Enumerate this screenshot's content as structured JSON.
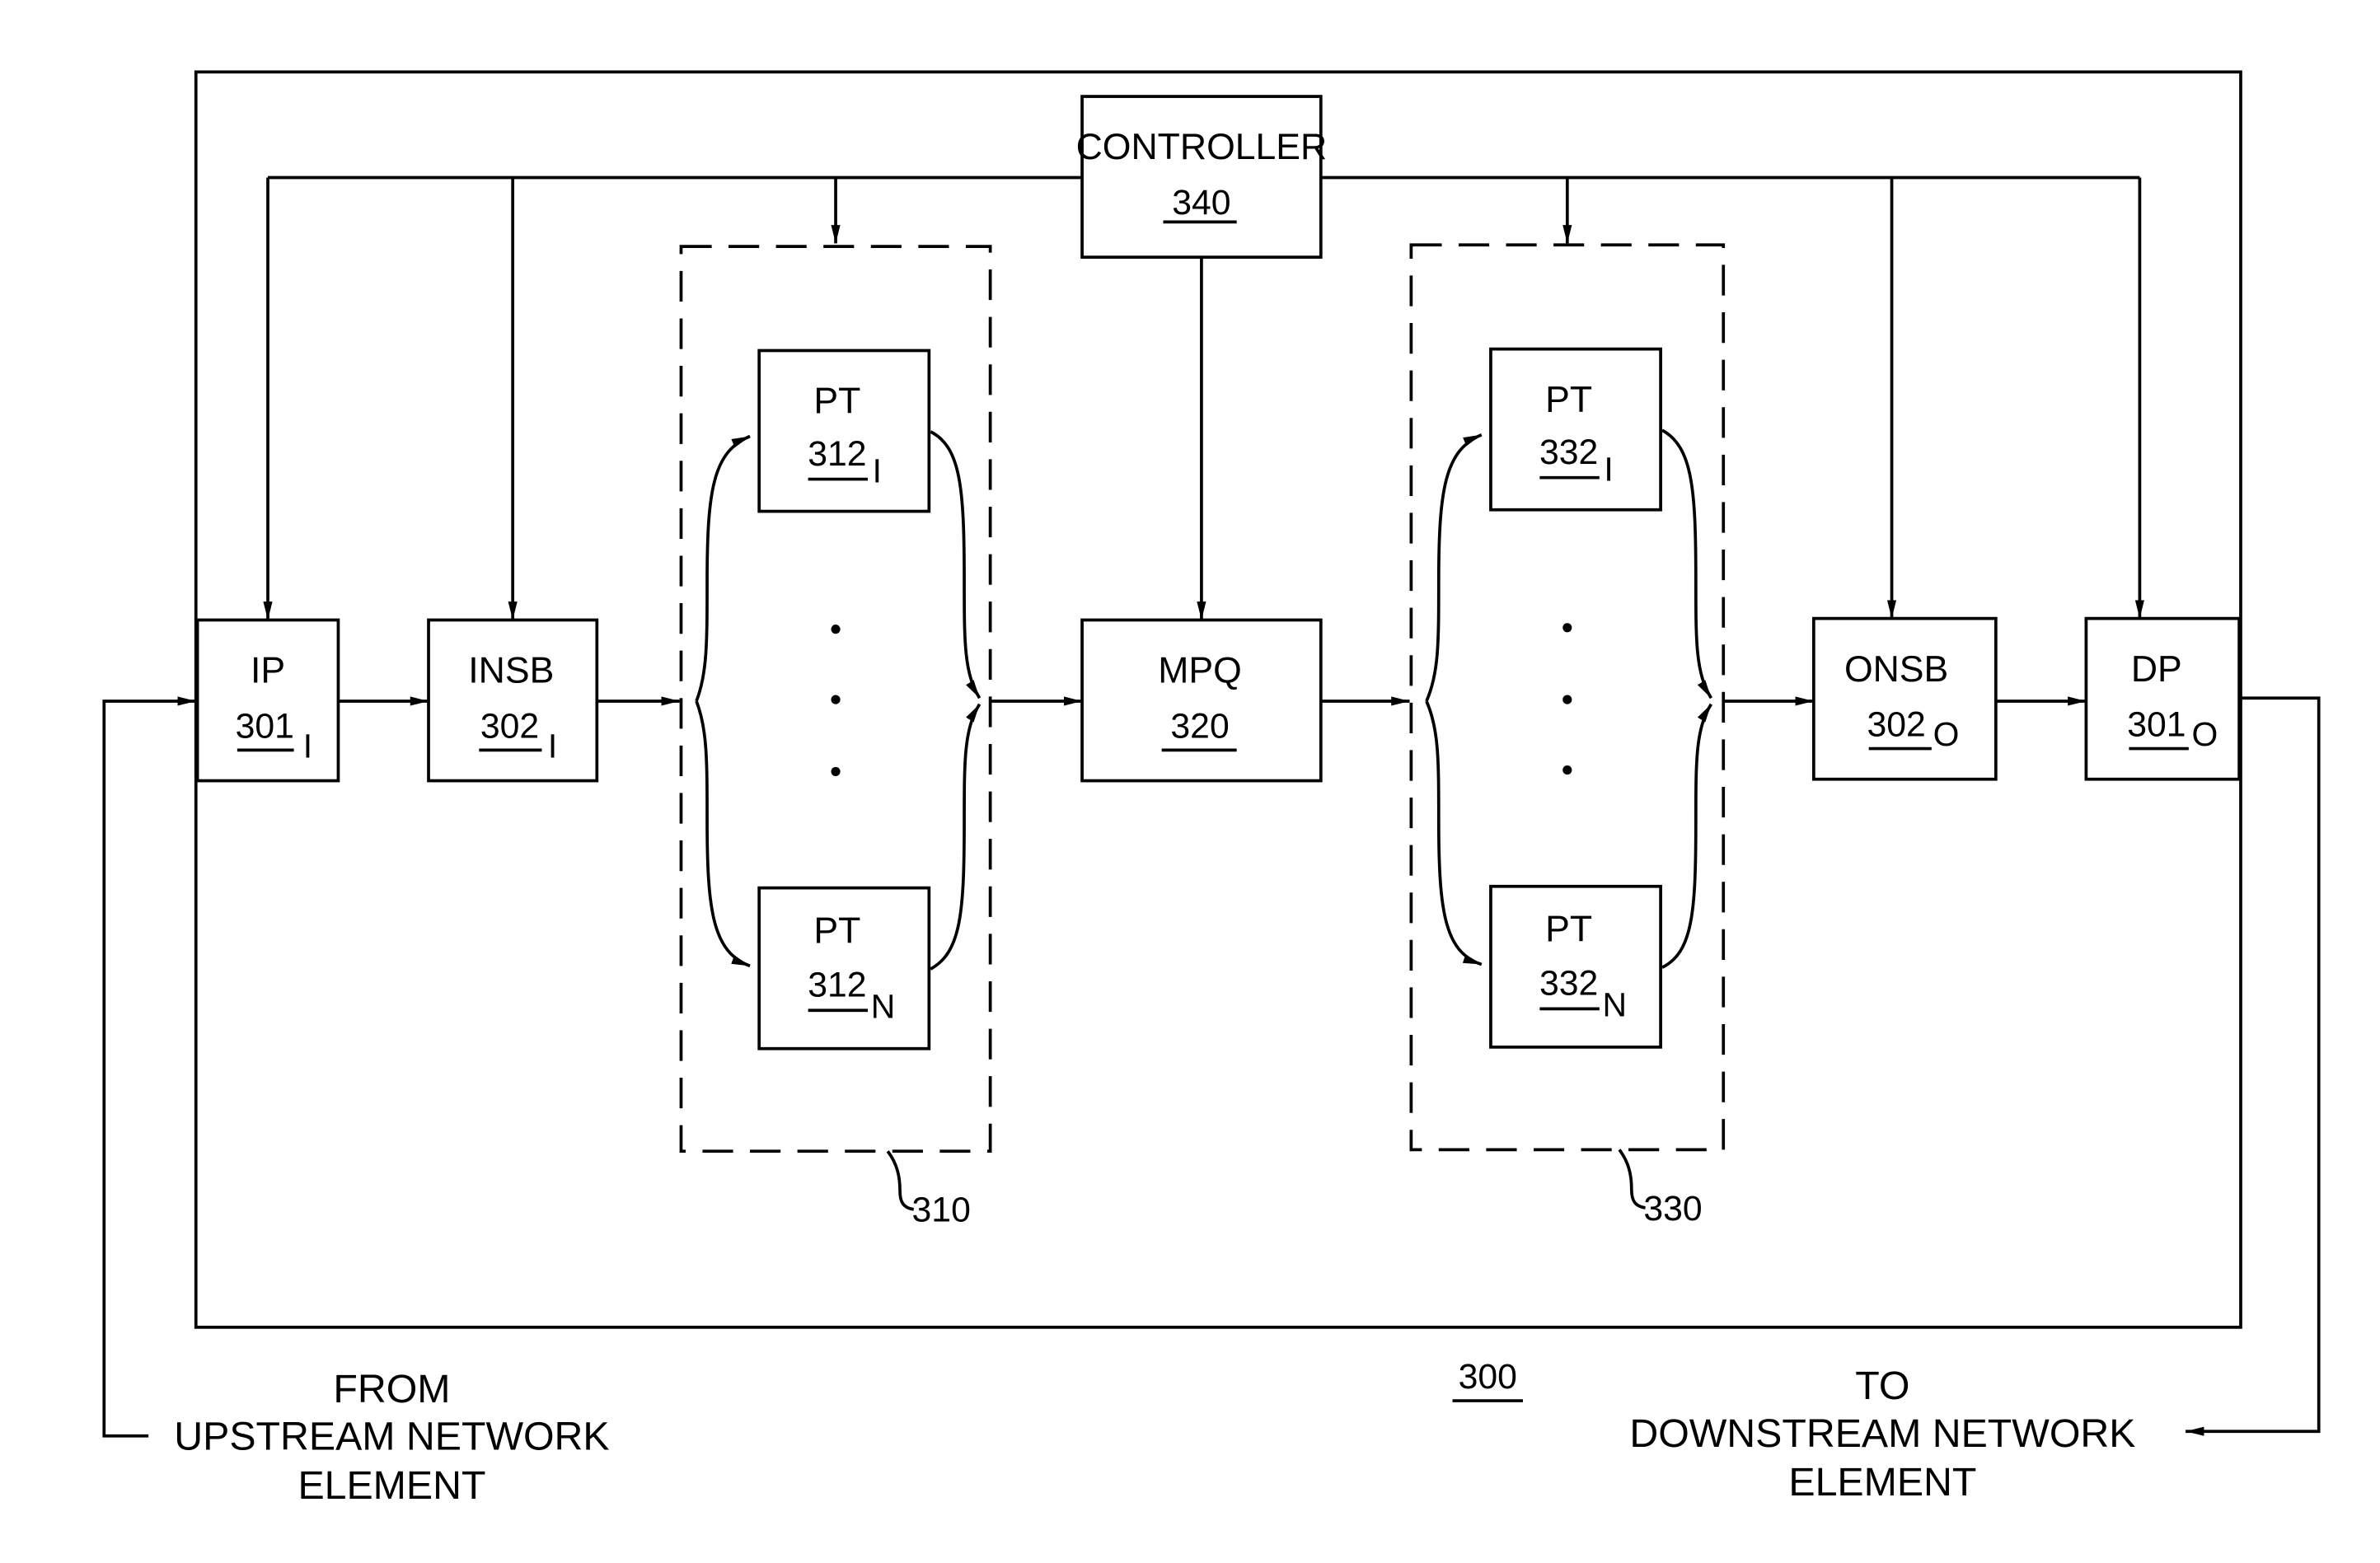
{
  "figure": {
    "reference": "300",
    "controller": {
      "label": "CONTROLLER",
      "ref": "340"
    },
    "blocks": {
      "ip": {
        "label": "IP",
        "ref": "301",
        "sub": "I"
      },
      "insb": {
        "label": "INSB",
        "ref": "302",
        "sub": "I"
      },
      "mpq": {
        "label": "MPQ",
        "ref": "320"
      },
      "onsb": {
        "label": "ONSB",
        "ref": "302",
        "sub": "O"
      },
      "dp": {
        "label": "DP",
        "ref": "301",
        "sub": "O"
      }
    },
    "groups": {
      "ingress_pool": {
        "ref": "310",
        "first": {
          "label": "PT",
          "ref": "312",
          "sub": "I"
        },
        "last": {
          "label": "PT",
          "ref": "312",
          "sub": "N"
        }
      },
      "egress_pool": {
        "ref": "330",
        "first": {
          "label": "PT",
          "ref": "332",
          "sub": "I"
        },
        "last": {
          "label": "PT",
          "ref": "332",
          "sub": "N"
        }
      }
    },
    "captions": {
      "from": [
        "FROM",
        "UPSTREAM NETWORK",
        "ELEMENT"
      ],
      "to": [
        "TO",
        "DOWNSTREAM NETWORK",
        "ELEMENT"
      ]
    }
  }
}
